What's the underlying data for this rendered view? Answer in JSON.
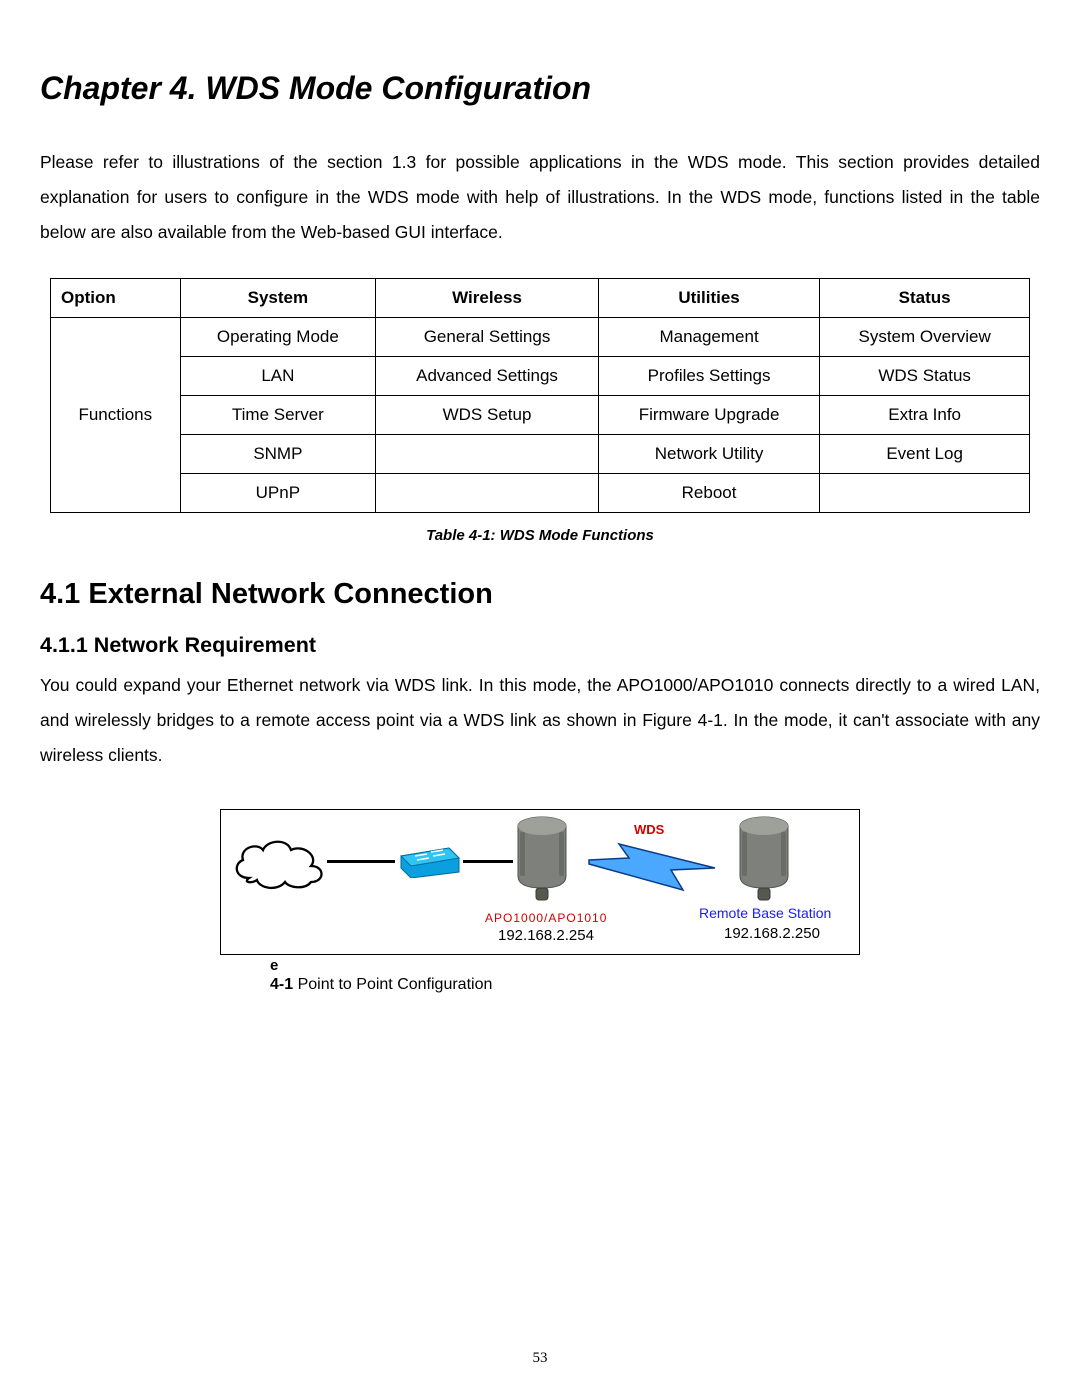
{
  "chapter_title": "Chapter 4. WDS Mode Configuration",
  "intro_paragraph": "Please refer to illustrations of the section 1.3 for possible applications in the WDS mode. This section provides detailed explanation for users to configure in the WDS mode with help of illustrations. In the WDS mode, functions listed in the table below are also available from the Web-based GUI interface.",
  "table": {
    "headers": [
      "Option",
      "System",
      "Wireless",
      "Utilities",
      "Status"
    ],
    "row_label": "Functions",
    "rows": [
      [
        "Operating Mode",
        "General Settings",
        "Management",
        "System Overview"
      ],
      [
        "LAN",
        "Advanced Settings",
        "Profiles Settings",
        "WDS Status"
      ],
      [
        "Time Server",
        "WDS Setup",
        "Firmware Upgrade",
        "Extra Info"
      ],
      [
        "SNMP",
        "",
        "Network Utility",
        "Event Log"
      ],
      [
        "UPnP",
        "",
        "Reboot",
        ""
      ]
    ],
    "caption": "Table 4-1: WDS Mode Functions"
  },
  "section_heading": "4.1 External Network Connection",
  "subsection_heading": "4.1.1 Network Requirement",
  "subsection_paragraph": "You could expand your Ethernet network via WDS link.  In this mode, the APO1000/APO1010 connects directly to a wired LAN, and wirelessly bridges to a remote access point via a WDS link as shown in Figure 4-1. In the mode, it can't associate with any wireless clients.",
  "diagram": {
    "wds_label": "WDS",
    "apo_label": "APO1000/APO1010",
    "ip_left": "192.168.2.254",
    "remote_label": "Remote Base Station",
    "ip_right": "192.168.2.250"
  },
  "stray_e": "e",
  "figure": {
    "number": "4-1",
    "text": " Point to Point Configuration"
  },
  "page_number": "53"
}
